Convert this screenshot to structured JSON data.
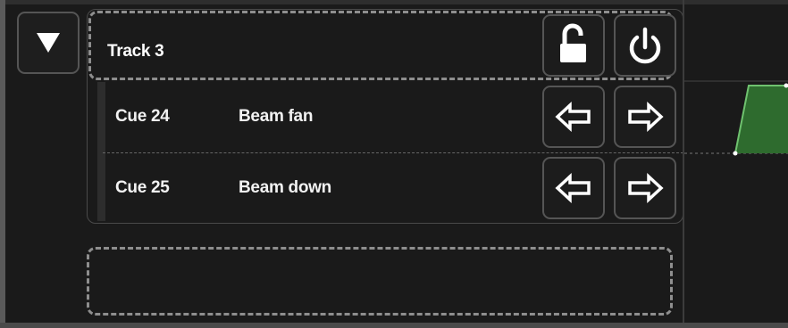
{
  "track": {
    "title": "Track 3",
    "lock_state": "unlocked",
    "lock_icon": "unlocked-padlock-icon",
    "power_icon": "power-icon"
  },
  "cues": [
    {
      "number": "Cue 24",
      "name": "Beam fan",
      "prev_icon": "arrow-left-icon",
      "next_icon": "arrow-right-icon"
    },
    {
      "number": "Cue 25",
      "name": "Beam down",
      "prev_icon": "arrow-left-icon",
      "next_icon": "arrow-right-icon"
    }
  ],
  "collapse_icon": "triangle-down-icon",
  "colors": {
    "background": "#1a1a1a",
    "button_border": "#555555",
    "dashed_outline": "#8e8e8e",
    "timeline_fill": "#2e6b2e",
    "timeline_stroke": "#6fc26f",
    "icon": "#ffffff"
  }
}
